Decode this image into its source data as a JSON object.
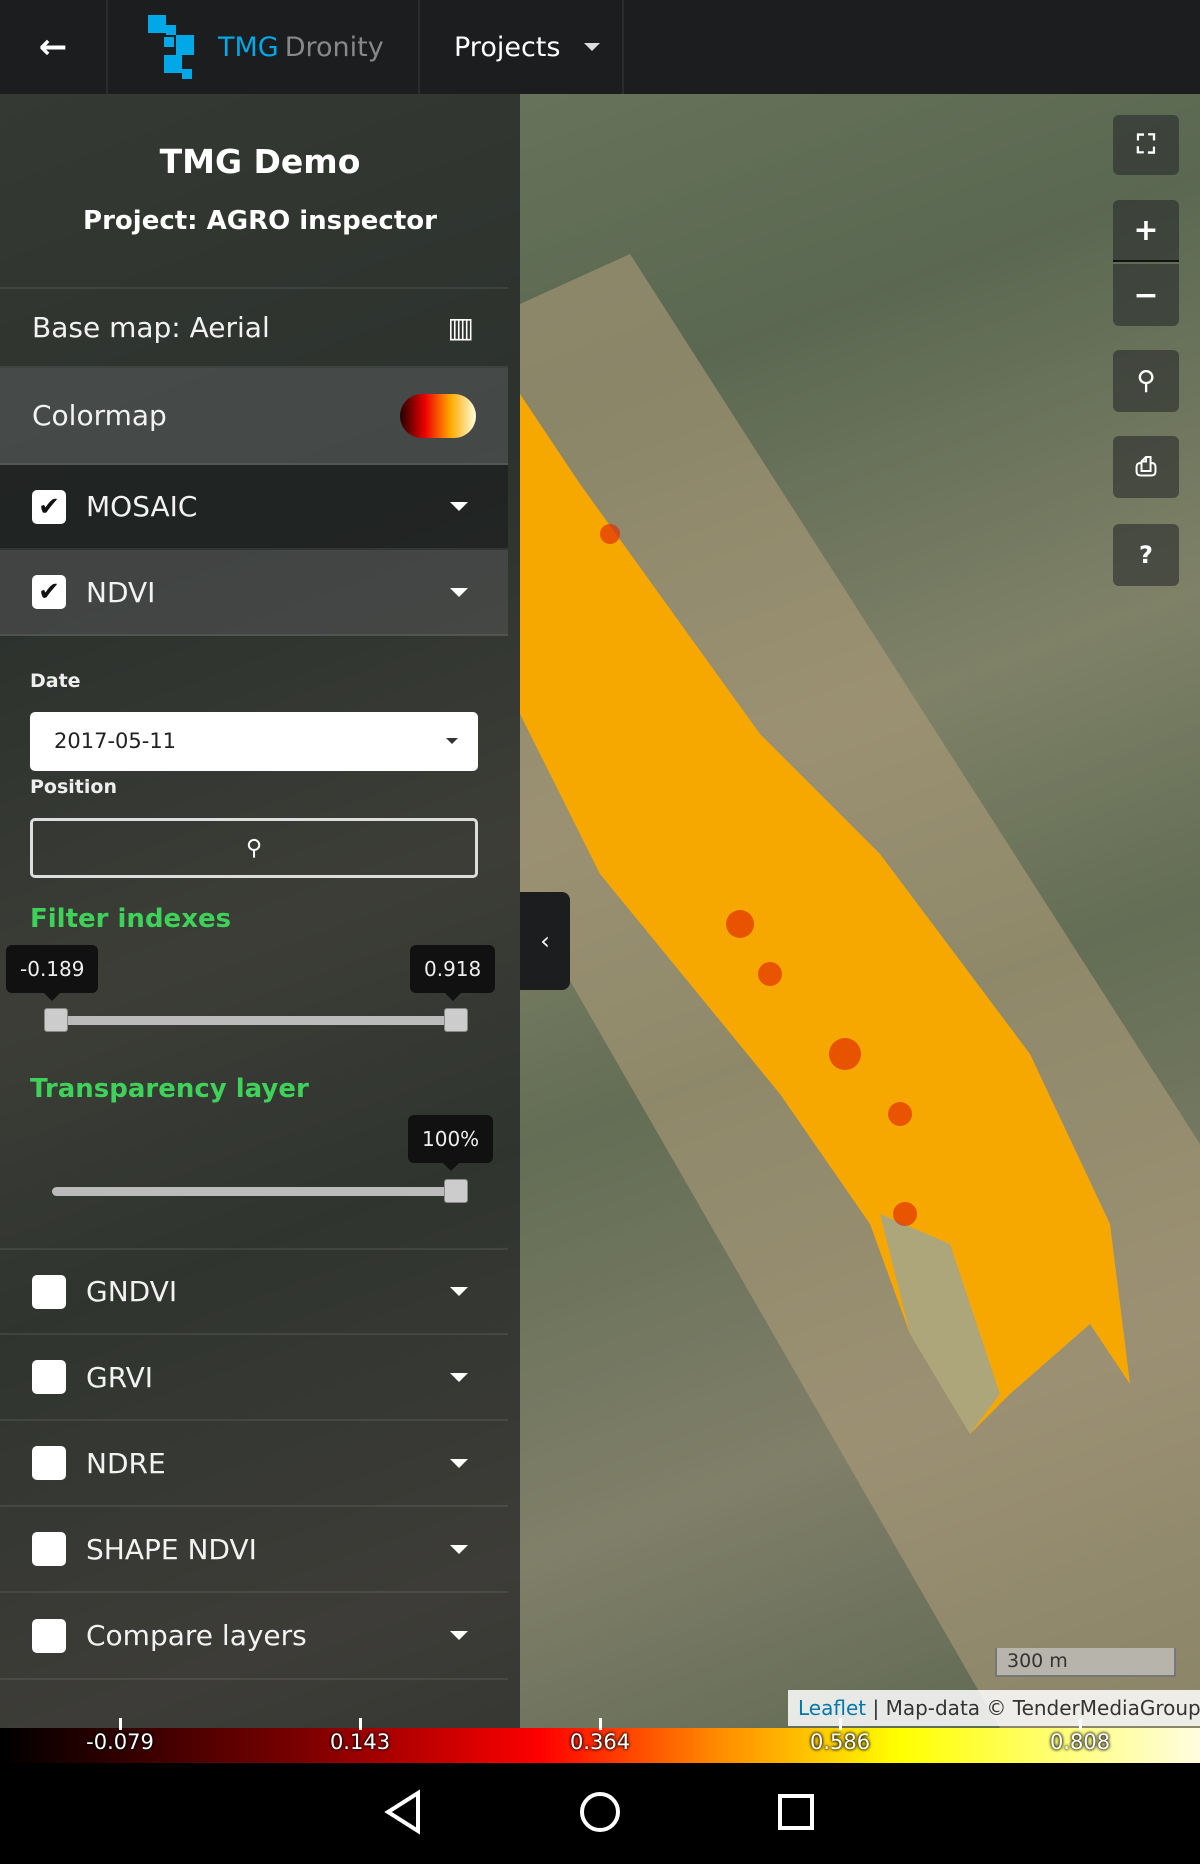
{
  "header": {
    "brand_primary": "TMG",
    "brand_secondary": "Dronity",
    "projects_label": "Projects",
    "brand_color": "#00a8e8"
  },
  "sidebar": {
    "title": "TMG Demo",
    "project": "Project: AGRO inspector",
    "base_map": "Base map: Aerial",
    "colormap": "Colormap",
    "layers_top": [
      {
        "label": "MOSAIC",
        "checked": true
      },
      {
        "label": "NDVI",
        "checked": true
      }
    ],
    "date_label": "Date",
    "date_value": "2017-05-11",
    "position_label": "Position",
    "filter_title": "Filter indexes",
    "filter_min": "-0.189",
    "filter_max": "0.918",
    "transparency_title": "Transparency layer",
    "transparency_value": "100%",
    "layers_bottom": [
      {
        "label": "GNDVI",
        "checked": false
      },
      {
        "label": "GRVI",
        "checked": false
      },
      {
        "label": "NDRE",
        "checked": false
      },
      {
        "label": "SHAPE NDVI",
        "checked": false
      },
      {
        "label": "Compare layers",
        "checked": false
      }
    ]
  },
  "map": {
    "scale": "300 m",
    "attribution_link": "Leaflet",
    "attribution_text": "| Map-data © TenderMediaGroup"
  },
  "colorbar": {
    "ticks": [
      "-0.079",
      "0.143",
      "0.364",
      "0.586",
      "0.808"
    ]
  },
  "accent_green": "#3fd25a"
}
